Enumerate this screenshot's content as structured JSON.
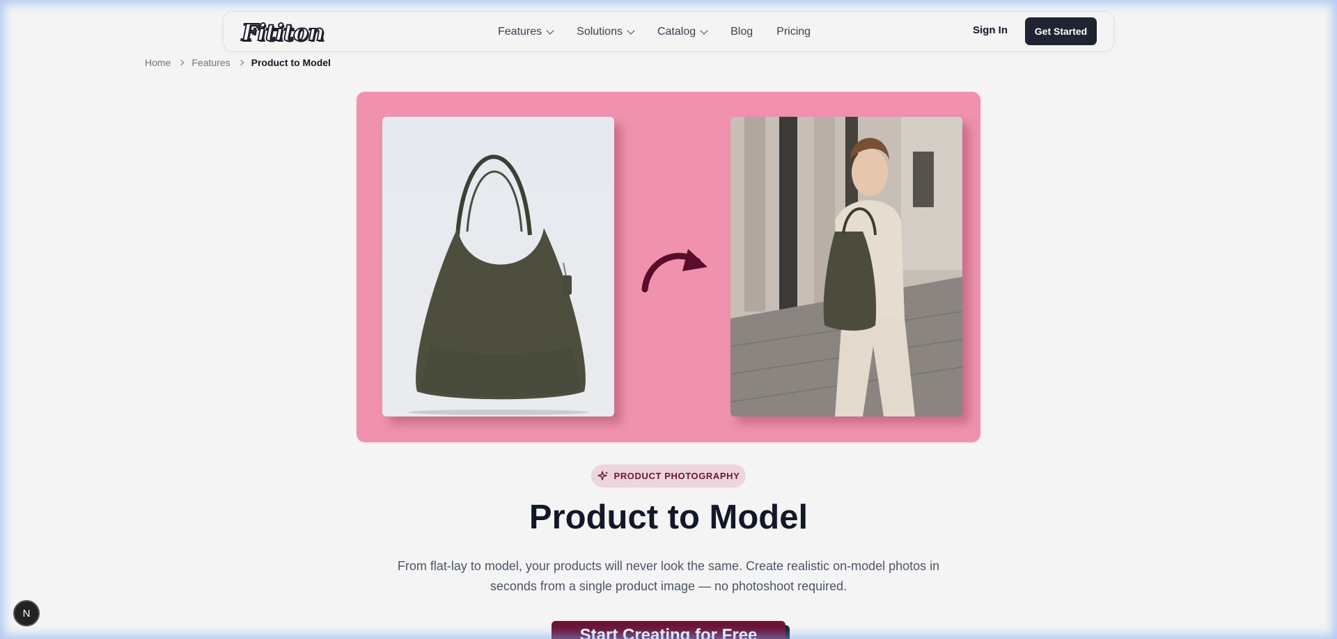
{
  "nav": {
    "logo": "Fititon",
    "items": [
      {
        "label": "Features",
        "has_dropdown": true
      },
      {
        "label": "Solutions",
        "has_dropdown": true
      },
      {
        "label": "Catalog",
        "has_dropdown": true
      },
      {
        "label": "Blog",
        "has_dropdown": false
      },
      {
        "label": "Pricing",
        "has_dropdown": false
      }
    ],
    "sign_in": "Sign In",
    "get_started": "Get Started"
  },
  "breadcrumb": {
    "items": [
      "Home",
      "Features"
    ],
    "current": "Product to Model"
  },
  "hero": {
    "background_color": "#f092ae",
    "left_image": "handbag-product-photo",
    "right_image": "model-with-handbag-photo",
    "arrow": "curved-arrow-icon"
  },
  "badge": {
    "icon": "sparkle-icon",
    "label": "PRODUCT PHOTOGRAPHY"
  },
  "title": "Product to Model",
  "subtitle": "From flat-lay to model, your products will never look the same. Create realistic on-model photos in seconds from a single product image — no photoshoot required.",
  "cta": {
    "label": "Start Creating for Free"
  },
  "fab": {
    "label": "N"
  },
  "colors": {
    "accent": "#6d1437",
    "dark": "#1e2432"
  }
}
